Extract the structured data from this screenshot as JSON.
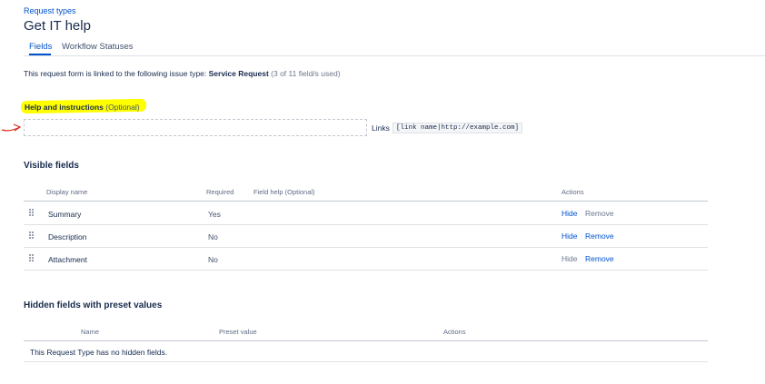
{
  "header": {
    "breadcrumb": "Request types",
    "title": "Get IT help",
    "tabs": [
      {
        "label": "Fields",
        "active": true
      },
      {
        "label": "Workflow Statuses",
        "active": false
      }
    ]
  },
  "info": {
    "prefix": "This request form is linked to the following issue type: ",
    "issue_type": "Service Request",
    "count": "(3 of 11 field/s used)"
  },
  "help": {
    "label": "Help and instructions",
    "optional": "(Optional)",
    "input_value": "",
    "links_label": "Links",
    "links_example": "[link name|http://example.com]",
    "highlight_color": "#ffff00",
    "annotation_color": "#d62d20"
  },
  "visible_fields": {
    "title": "Visible fields",
    "columns": {
      "display_name": "Display name",
      "required": "Required",
      "field_help": "Field help",
      "field_help_opt": "(Optional)",
      "actions": "Actions"
    },
    "rows": [
      {
        "name": "Summary",
        "required": "Yes",
        "hide": "Hide",
        "remove": "Remove",
        "hide_enabled": true,
        "remove_enabled": false
      },
      {
        "name": "Description",
        "required": "No",
        "hide": "Hide",
        "remove": "Remove",
        "hide_enabled": true,
        "remove_enabled": true
      },
      {
        "name": "Attachment",
        "required": "No",
        "hide": "Hide",
        "remove": "Remove",
        "hide_enabled": false,
        "remove_enabled": true
      }
    ]
  },
  "hidden_fields": {
    "title": "Hidden fields with preset values",
    "columns": {
      "name": "Name",
      "preset": "Preset value",
      "actions": "Actions"
    },
    "empty_text": "This Request Type has no hidden fields."
  },
  "colors": {
    "link": "#0052cc",
    "text": "#172b4d",
    "muted": "#6b778c"
  }
}
